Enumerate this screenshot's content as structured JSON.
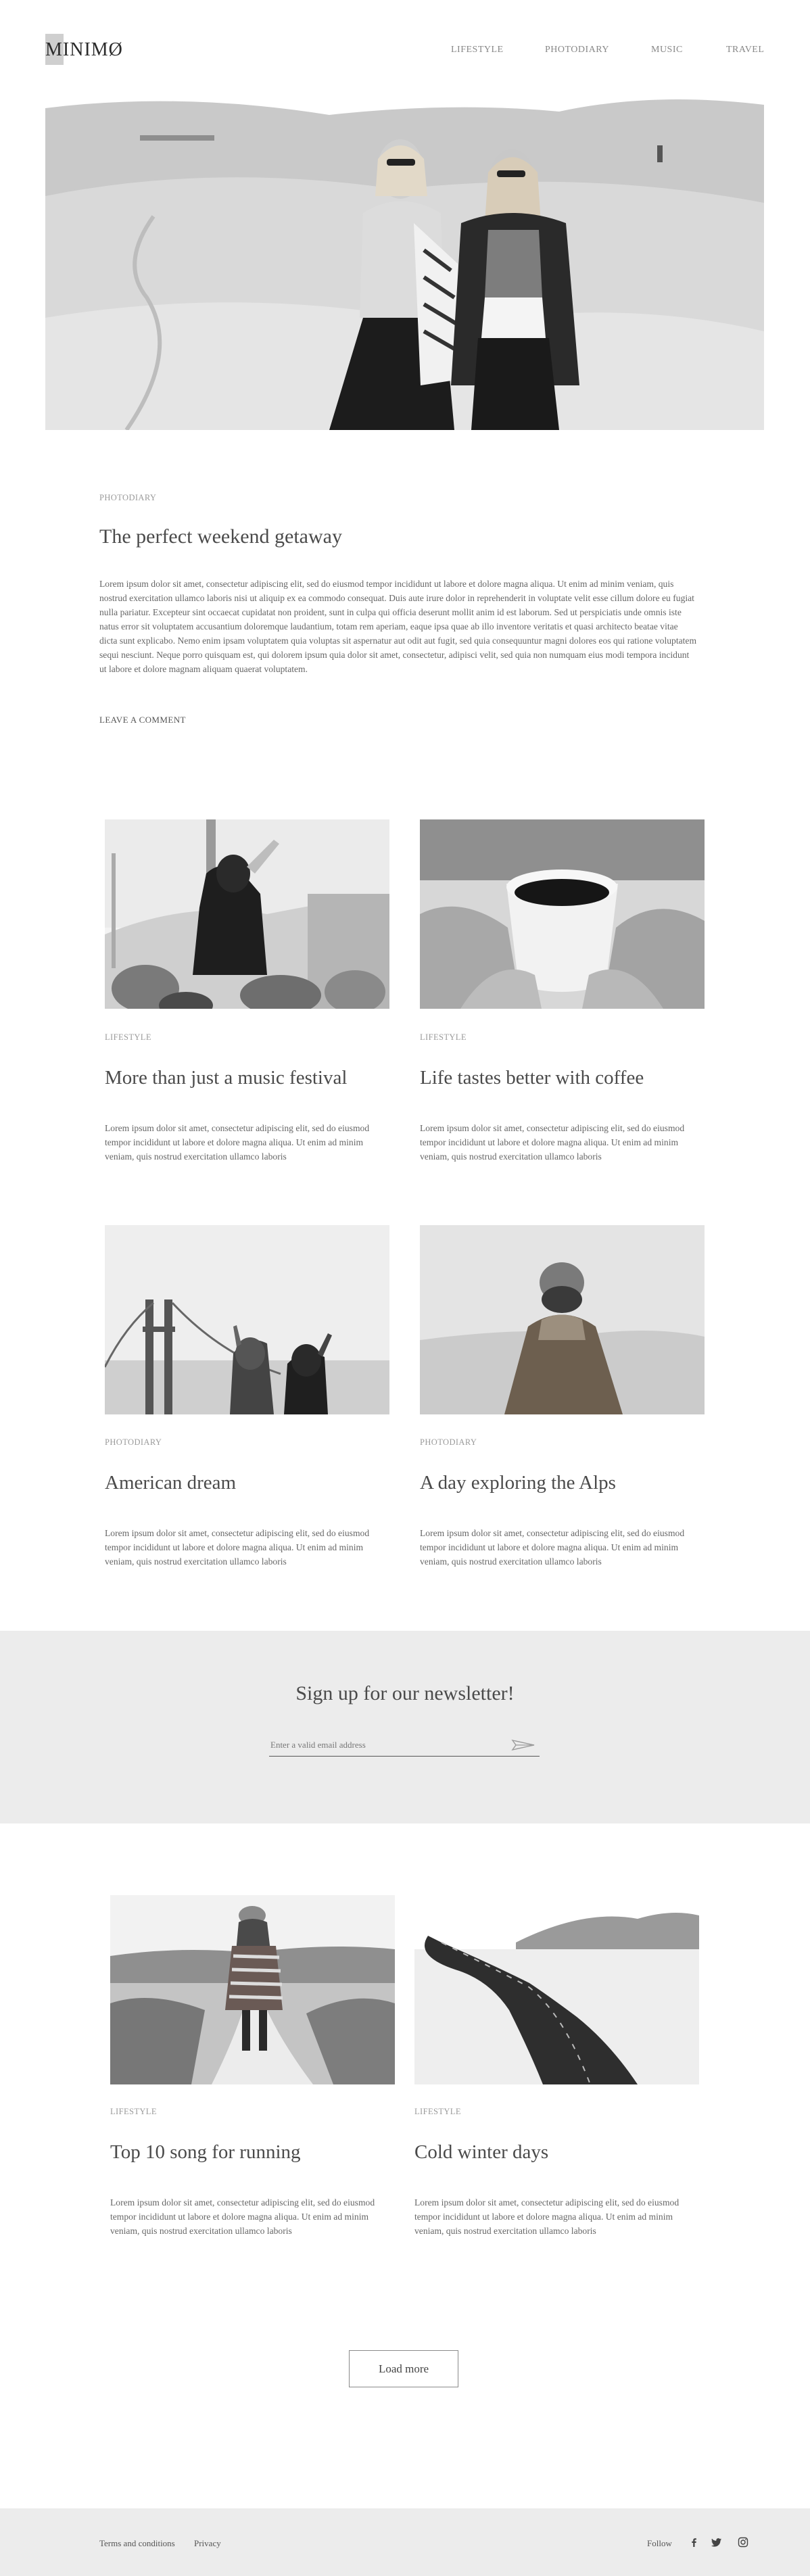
{
  "header": {
    "logo": "MINIMØ",
    "nav": [
      "LIFESTYLE",
      "PHOTODIARY",
      "MUSIC",
      "TRAVEL"
    ]
  },
  "hero": {
    "image_alt": "two-women-snow-photo",
    "category": "PHOTODIARY",
    "title": "The perfect weekend getaway",
    "body": "Lorem ipsum dolor sit amet, consectetur adipiscing elit, sed do eiusmod tempor incididunt ut labore et dolore magna aliqua. Ut enim ad minim veniam, quis nostrud exercitation ullamco laboris nisi ut aliquip ex ea commodo consequat. Duis aute irure dolor in reprehenderit in voluptate velit esse cillum dolore eu fugiat nulla pariatur. Excepteur sint occaecat cupidatat non proident, sunt in culpa qui officia deserunt mollit anim id est laborum. Sed ut perspiciatis unde omnis iste natus error sit voluptatem accusantium doloremque laudantium, totam rem aperiam, eaque ipsa quae ab illo inventore veritatis et quasi architecto beatae vitae dicta sunt explicabo. Nemo enim ipsam voluptatem quia voluptas sit aspernatur aut odit aut fugit, sed quia consequuntur magni dolores eos qui ratione voluptatem sequi nesciunt. Neque porro quisquam est, qui dolorem ipsum quia dolor sit amet, consectetur, adipisci velit, sed quia non numquam eius modi tempora incidunt ut labore et dolore magnam aliquam quaerat voluptatem.",
    "leave_comment": "LEAVE A COMMENT"
  },
  "posts": [
    {
      "category": "LIFESTYLE",
      "title": "More than just a music festival",
      "body": "Lorem ipsum dolor sit amet, consectetur adipiscing elit, sed do eiusmod tempor incididunt ut labore et dolore magna aliqua. Ut enim ad minim veniam, quis nostrud exercitation ullamco laboris"
    },
    {
      "category": "LIFESTYLE",
      "title": "Life tastes better with coffee",
      "body": "Lorem ipsum dolor sit amet, consectetur adipiscing elit, sed do eiusmod tempor incididunt ut labore et dolore magna aliqua. Ut enim ad minim veniam, quis nostrud exercitation ullamco laboris"
    },
    {
      "category": "PHOTODIARY",
      "title": "American dream",
      "body": "Lorem ipsum dolor sit amet, consectetur adipiscing elit, sed do eiusmod tempor incididunt ut labore et dolore magna aliqua. Ut enim ad minim veniam, quis nostrud exercitation ullamco laboris"
    },
    {
      "category": "PHOTODIARY",
      "title": "A day exploring the Alps",
      "body": "Lorem ipsum dolor sit amet, consectetur adipiscing elit, sed do eiusmod tempor incididunt ut labore et dolore magna aliqua. Ut enim ad minim veniam, quis nostrud exercitation ullamco laboris"
    },
    {
      "category": "LIFESTYLE",
      "title": "Top 10 song for running",
      "body": "Lorem ipsum dolor sit amet, consectetur adipiscing elit, sed do eiusmod tempor incididunt ut labore et dolore magna aliqua. Ut enim ad minim veniam, quis nostrud exercitation ullamco laboris"
    },
    {
      "category": "LIFESTYLE",
      "title": "Cold winter days",
      "body": "Lorem ipsum dolor sit amet, consectetur adipiscing elit, sed do eiusmod tempor incididunt ut labore et dolore magna aliqua. Ut enim ad minim veniam, quis nostrud exercitation ullamco laboris"
    }
  ],
  "newsletter": {
    "title": "Sign up for our newsletter!",
    "placeholder": "Enter a valid email address",
    "send_icon": "paper-plane-icon"
  },
  "load_more": "Load more",
  "footer": {
    "terms": "Terms and conditions",
    "privacy": "Privacy",
    "follow": "Follow",
    "social_icons": [
      "facebook-icon",
      "twitter-icon",
      "instagram-icon"
    ]
  },
  "colors": {
    "background": "#ffffff",
    "band": "#ececec",
    "text": "#4a4a4a",
    "muted": "#9a9a9a",
    "logo_accent": "#cfcfcf"
  }
}
